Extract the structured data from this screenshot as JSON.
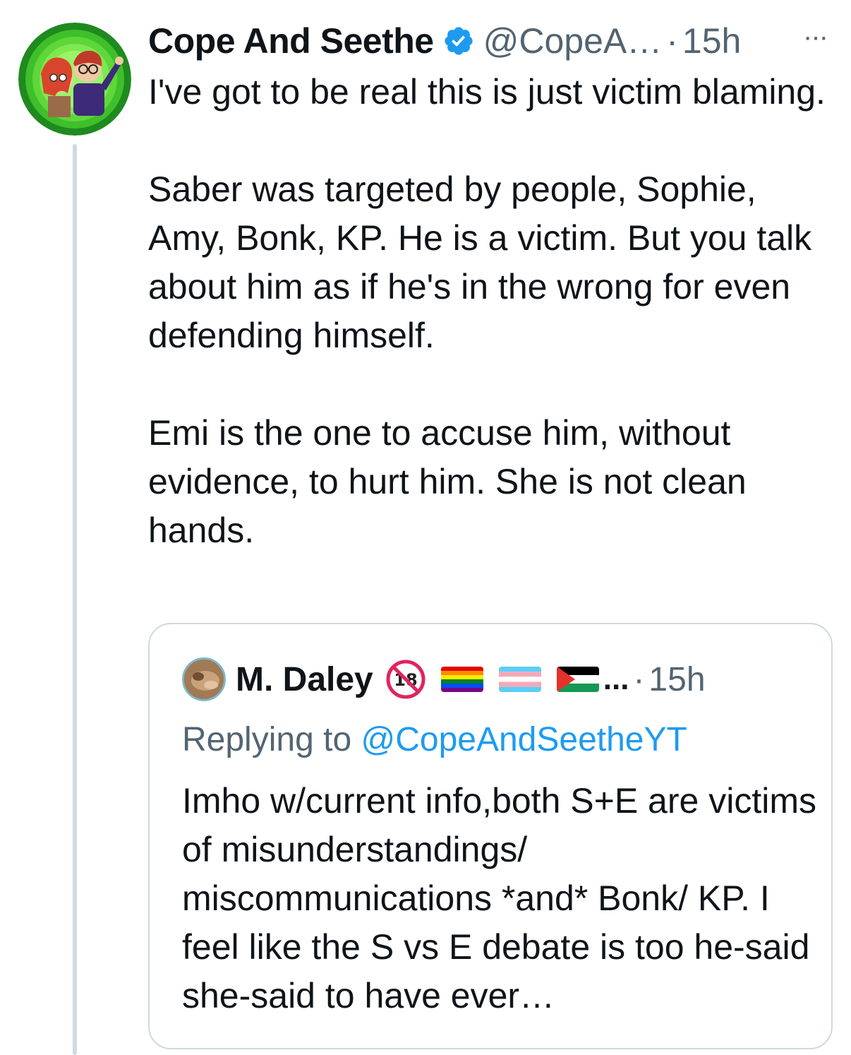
{
  "tweet": {
    "author_name": "Cope And Seethe",
    "handle": "@CopeA…",
    "separator": "·",
    "time": "15h",
    "more_label": "···",
    "paragraphs": [
      "I've got to be real this is just victim blaming.",
      "Saber was targeted by people, Sophie, Amy, Bonk, KP. He is a victim. But you talk about him as if he's in the wrong for even defending himself.",
      "Emi is the one to accuse him, without evidence, to hurt him. She is not clean hands."
    ],
    "verified_icon": "verified-badge-icon",
    "avatar_icon": "avatar-image"
  },
  "quote": {
    "author_name": "M. Daley",
    "ellipsis": "...",
    "separator": "·",
    "time": "15h",
    "replying_prefix": "Replying to ",
    "replying_handle": "@CopeAndSeetheYT",
    "text": "Imho w/current info,both S+E are victims of misunderstandings/ miscommunications *and* Bonk/ KP. I feel like the S vs E debate is too he-said she-said to have ever…",
    "badges": [
      "no-18-icon",
      "rainbow-flag-icon",
      "transgender-flag-icon",
      "palestine-flag-icon"
    ]
  },
  "colors": {
    "text": "#0f1419",
    "secondary": "#536471",
    "link": "#1d9bf0",
    "border": "#cfd9de",
    "verified": "#1d9bf0"
  }
}
